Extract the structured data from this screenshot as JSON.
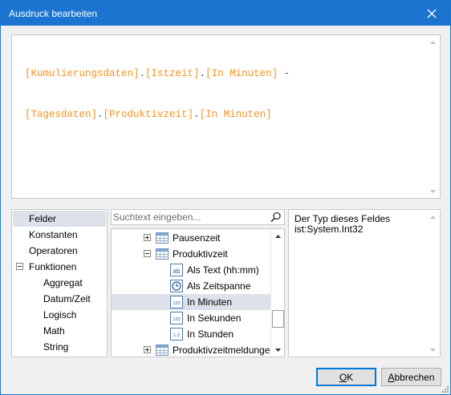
{
  "window": {
    "title": "Ausdruck bearbeiten"
  },
  "expression": {
    "line1": [
      {
        "t": "[Kumulierungsdaten]",
        "k": "field"
      },
      {
        "t": ".",
        "k": "punct"
      },
      {
        "t": "[Istzeit]",
        "k": "field"
      },
      {
        "t": ".",
        "k": "punct"
      },
      {
        "t": "[In Minuten]",
        "k": "field"
      },
      {
        "t": " -",
        "k": "punct"
      }
    ],
    "line2": [
      {
        "t": "[Tagesdaten]",
        "k": "field"
      },
      {
        "t": ".",
        "k": "punct"
      },
      {
        "t": "[Produktivzeit]",
        "k": "field"
      },
      {
        "t": ".",
        "k": "punct"
      },
      {
        "t": "[In Minuten]",
        "k": "field"
      }
    ]
  },
  "categories": [
    {
      "label": "Felder",
      "selected": true,
      "indent": 0,
      "expander": null
    },
    {
      "label": "Konstanten",
      "selected": false,
      "indent": 0,
      "expander": null
    },
    {
      "label": "Operatoren",
      "selected": false,
      "indent": 0,
      "expander": null
    },
    {
      "label": "Funktionen",
      "selected": false,
      "indent": 0,
      "expander": "minus"
    },
    {
      "label": "Aggregat",
      "selected": false,
      "indent": 1,
      "expander": null
    },
    {
      "label": "Datum/Zeit",
      "selected": false,
      "indent": 1,
      "expander": null
    },
    {
      "label": "Logisch",
      "selected": false,
      "indent": 1,
      "expander": null
    },
    {
      "label": "Math",
      "selected": false,
      "indent": 1,
      "expander": null
    },
    {
      "label": "String",
      "selected": false,
      "indent": 1,
      "expander": null
    }
  ],
  "search": {
    "placeholder": "Suchtext eingeben..."
  },
  "tree": [
    {
      "label": "Pausenzeit",
      "level": 0,
      "expander": "plus",
      "icon": "table-icon",
      "selected": false
    },
    {
      "label": "Produktivzeit",
      "level": 0,
      "expander": "minus",
      "icon": "table-icon",
      "selected": false
    },
    {
      "label": "Als Text (hh:mm)",
      "level": 1,
      "expander": null,
      "icon": "text-field-icon",
      "selected": false
    },
    {
      "label": "Als Zeitspanne",
      "level": 1,
      "expander": null,
      "icon": "timespan-field-icon",
      "selected": false
    },
    {
      "label": "In Minuten",
      "level": 1,
      "expander": null,
      "icon": "integer-field-icon",
      "selected": true
    },
    {
      "label": "In Sekunden",
      "level": 1,
      "expander": null,
      "icon": "integer-field-icon",
      "selected": false
    },
    {
      "label": "In Stunden",
      "level": 1,
      "expander": null,
      "icon": "decimal-field-icon",
      "selected": false
    },
    {
      "label": "Produktivzeitmeldungen",
      "level": 0,
      "expander": "plus",
      "icon": "table-icon",
      "selected": false
    }
  ],
  "description": {
    "text": "Der Typ dieses Feldes ist:System.Int32"
  },
  "buttons": {
    "ok": {
      "mnemonic": "O",
      "rest": "K"
    },
    "cancel": {
      "mnemonic": "A",
      "rest": "bbrechen"
    }
  },
  "colors": {
    "titlebar": "#1a74d0",
    "field_token": "#f7931e",
    "selection": "#dde1ea"
  }
}
